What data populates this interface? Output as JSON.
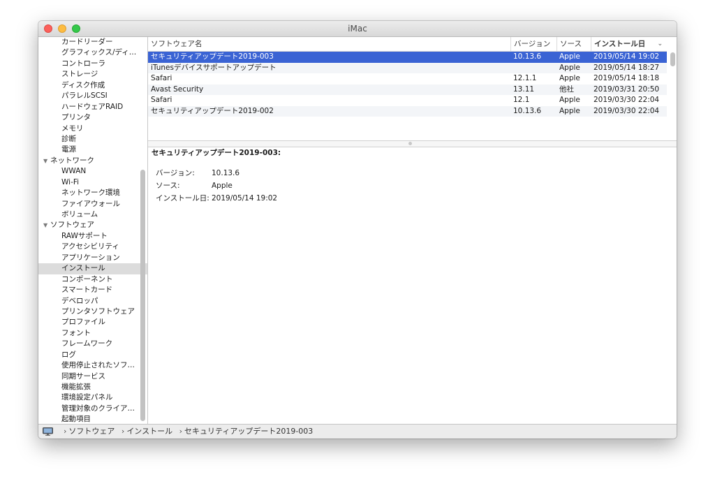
{
  "window": {
    "title": "iMac"
  },
  "sidebar": {
    "items": [
      {
        "label": "カードリーダー",
        "kind": "child"
      },
      {
        "label": "グラフィックス/ディ…",
        "kind": "child"
      },
      {
        "label": "コントローラ",
        "kind": "child"
      },
      {
        "label": "ストレージ",
        "kind": "child"
      },
      {
        "label": "ディスク作成",
        "kind": "child"
      },
      {
        "label": "パラレルSCSI",
        "kind": "child"
      },
      {
        "label": "ハードウェアRAID",
        "kind": "child"
      },
      {
        "label": "プリンタ",
        "kind": "child"
      },
      {
        "label": "メモリ",
        "kind": "child"
      },
      {
        "label": "診断",
        "kind": "child"
      },
      {
        "label": "電源",
        "kind": "child"
      },
      {
        "label": "ネットワーク",
        "kind": "group"
      },
      {
        "label": "WWAN",
        "kind": "child"
      },
      {
        "label": "Wi-Fi",
        "kind": "child"
      },
      {
        "label": "ネットワーク環境",
        "kind": "child"
      },
      {
        "label": "ファイアウォール",
        "kind": "child"
      },
      {
        "label": "ボリューム",
        "kind": "child"
      },
      {
        "label": "ソフトウェア",
        "kind": "group"
      },
      {
        "label": "RAWサポート",
        "kind": "child"
      },
      {
        "label": "アクセシビリティ",
        "kind": "child"
      },
      {
        "label": "アプリケーション",
        "kind": "child"
      },
      {
        "label": "インストール",
        "kind": "child",
        "selected": true
      },
      {
        "label": "コンポーネント",
        "kind": "child"
      },
      {
        "label": "スマートカード",
        "kind": "child"
      },
      {
        "label": "デベロッパ",
        "kind": "child"
      },
      {
        "label": "プリンタソフトウェア",
        "kind": "child"
      },
      {
        "label": "プロファイル",
        "kind": "child"
      },
      {
        "label": "フォント",
        "kind": "child"
      },
      {
        "label": "フレームワーク",
        "kind": "child"
      },
      {
        "label": "ログ",
        "kind": "child"
      },
      {
        "label": "使用停止されたソフ…",
        "kind": "child"
      },
      {
        "label": "同期サービス",
        "kind": "child"
      },
      {
        "label": "機能拡張",
        "kind": "child"
      },
      {
        "label": "環境設定パネル",
        "kind": "child"
      },
      {
        "label": "管理対象のクライア…",
        "kind": "child"
      },
      {
        "label": "起動項目",
        "kind": "child"
      }
    ]
  },
  "table": {
    "columns": [
      "ソフトウェア名",
      "バージョン",
      "ソース",
      "インストール日"
    ],
    "rows": [
      [
        "セキュリティアップデート2019-003",
        "10.13.6",
        "Apple",
        "2019/05/14 19:02"
      ],
      [
        "iTunesデバイスサポートアップデート",
        "",
        "Apple",
        "2019/05/14 18:27"
      ],
      [
        "Safari",
        "12.1.1",
        "Apple",
        "2019/05/14 18:18"
      ],
      [
        "Avast Security",
        "13.11",
        "他社",
        "2019/03/31 20:50"
      ],
      [
        "Safari",
        "12.1",
        "Apple",
        "2019/03/30 22:04"
      ],
      [
        "セキュリティアップデート2019-002",
        "10.13.6",
        "Apple",
        "2019/03/30 22:04"
      ]
    ],
    "selected_row": 0
  },
  "detail": {
    "title": "セキュリティアップデート2019-003:",
    "fields": [
      {
        "key": "バージョン:",
        "value": "10.13.6"
      },
      {
        "key": "ソース:",
        "value": "Apple"
      },
      {
        "key": "インストール日:",
        "value": "2019/05/14 19:02"
      }
    ]
  },
  "breadcrumb": [
    "ソフトウェア",
    "インストール",
    "セキュリティアップデート2019-003"
  ],
  "colors": {
    "selection": "#3a63d4",
    "sidebar_selected": "#dcdcdc"
  }
}
